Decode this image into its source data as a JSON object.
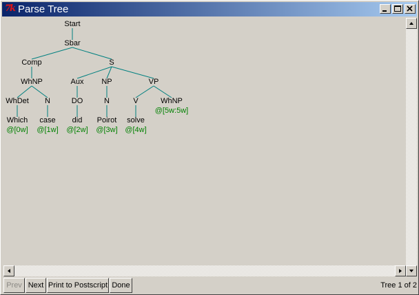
{
  "window": {
    "title": "Parse Tree",
    "logo_text": "7k"
  },
  "tree": {
    "nodes": [
      {
        "id": "start",
        "label": "Start",
        "kind": "label"
      },
      {
        "id": "sbar",
        "label": "Sbar",
        "kind": "label"
      },
      {
        "id": "comp",
        "label": "Comp",
        "kind": "label"
      },
      {
        "id": "s",
        "label": "S",
        "kind": "label"
      },
      {
        "id": "whnp1",
        "label": "WhNP",
        "kind": "label"
      },
      {
        "id": "aux",
        "label": "Aux",
        "kind": "label"
      },
      {
        "id": "np",
        "label": "NP",
        "kind": "label"
      },
      {
        "id": "vp",
        "label": "VP",
        "kind": "label"
      },
      {
        "id": "whdet",
        "label": "WhDet",
        "kind": "label"
      },
      {
        "id": "n1",
        "label": "N",
        "kind": "label"
      },
      {
        "id": "do",
        "label": "DO",
        "kind": "label"
      },
      {
        "id": "n2",
        "label": "N",
        "kind": "label"
      },
      {
        "id": "v",
        "label": "V",
        "kind": "label"
      },
      {
        "id": "whnp2",
        "label": "WhNP",
        "kind": "label"
      },
      {
        "id": "which",
        "label": "Which",
        "kind": "word"
      },
      {
        "id": "case",
        "label": "case",
        "kind": "word"
      },
      {
        "id": "did",
        "label": "did",
        "kind": "word"
      },
      {
        "id": "poirot",
        "label": "Poirot",
        "kind": "word"
      },
      {
        "id": "solve",
        "label": "solve",
        "kind": "word"
      },
      {
        "id": "pos0",
        "label": "@[0w]",
        "kind": "pos"
      },
      {
        "id": "pos1",
        "label": "@[1w]",
        "kind": "pos"
      },
      {
        "id": "pos2",
        "label": "@[2w]",
        "kind": "pos"
      },
      {
        "id": "pos3",
        "label": "@[3w]",
        "kind": "pos"
      },
      {
        "id": "pos4",
        "label": "@[4w]",
        "kind": "pos"
      },
      {
        "id": "pos5",
        "label": "@[5w:5w]",
        "kind": "pos"
      }
    ],
    "edges": [
      [
        "start",
        "sbar"
      ],
      [
        "sbar",
        "comp"
      ],
      [
        "sbar",
        "s"
      ],
      [
        "comp",
        "whnp1"
      ],
      [
        "whnp1",
        "whdet"
      ],
      [
        "whnp1",
        "n1"
      ],
      [
        "whdet",
        "which"
      ],
      [
        "n1",
        "case"
      ],
      [
        "s",
        "aux"
      ],
      [
        "s",
        "np"
      ],
      [
        "s",
        "vp"
      ],
      [
        "aux",
        "do"
      ],
      [
        "do",
        "did"
      ],
      [
        "np",
        "n2"
      ],
      [
        "n2",
        "poirot"
      ],
      [
        "vp",
        "v"
      ],
      [
        "vp",
        "whnp2"
      ],
      [
        "v",
        "solve"
      ]
    ],
    "colors": {
      "edge": "#008080",
      "label": "#000000",
      "position": "#008000"
    }
  },
  "buttons": {
    "prev": "Prev",
    "next": "Next",
    "print": "Print to Postscript",
    "done": "Done"
  },
  "status": "Tree 1 of 2"
}
